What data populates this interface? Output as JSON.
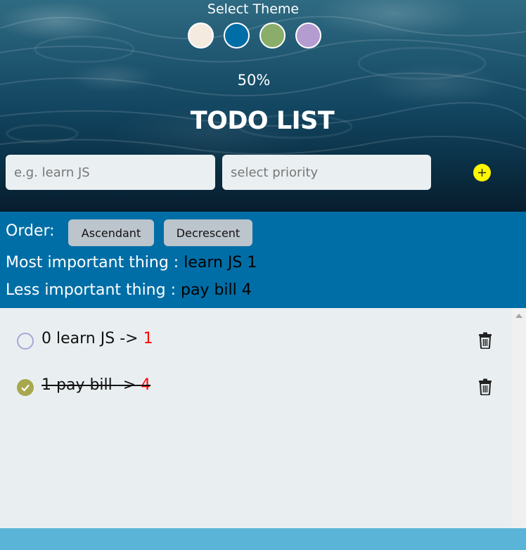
{
  "theme": {
    "title": "Select Theme",
    "swatches": [
      {
        "name": "cream",
        "color": "#f5eae0"
      },
      {
        "name": "blue",
        "color": "#006ea6"
      },
      {
        "name": "green",
        "color": "#8aad6a"
      },
      {
        "name": "lavender",
        "color": "#b49bd0"
      }
    ]
  },
  "progress": {
    "text": "50%",
    "value": 0.5
  },
  "app": {
    "title": "TODO LIST"
  },
  "form": {
    "task_placeholder": "e.g. learn JS",
    "priority_placeholder": "select priority",
    "add_icon": "plus-icon"
  },
  "order": {
    "label": "Order:",
    "asc_label": "Ascendant",
    "desc_label": "Decrescent"
  },
  "summary": {
    "most_label": "Most important thing :",
    "most_value": "learn JS 1",
    "less_label": "Less important thing :",
    "less_value": "pay bill 4"
  },
  "todos": [
    {
      "index": "0",
      "task": "learn JS",
      "arrow": "->",
      "priority": "1",
      "done": false
    },
    {
      "index": "1",
      "task": "pay bill",
      "arrow": "->",
      "priority": "4",
      "done": true
    }
  ],
  "colors": {
    "accent": "#006ea6",
    "priority": "#ff0000",
    "done_check": "#a7a84d",
    "add_button": "#fff700",
    "footer": "#5ab4d8"
  }
}
